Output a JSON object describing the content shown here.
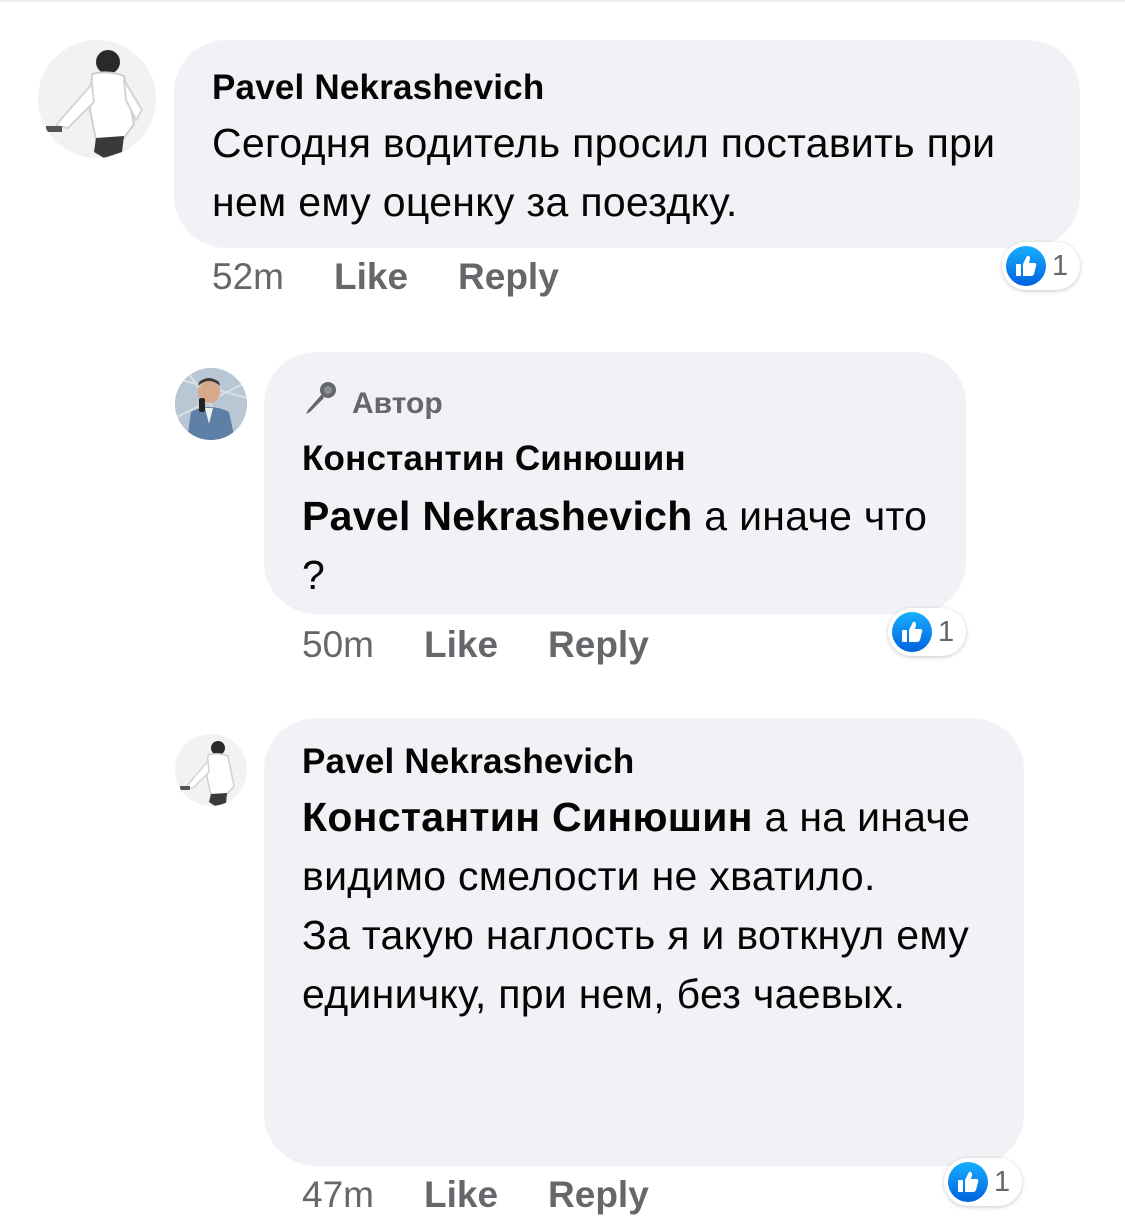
{
  "colors": {
    "bubble_bg": "#f0f2f5",
    "meta_text": "#65676b",
    "like_blue": "#1877f2"
  },
  "comments": [
    {
      "author": "Pavel Nekrashevich",
      "text": "Сегодня водитель просил поставить при нем ему оценку за поездку.",
      "time": "52m",
      "like_label": "Like",
      "reply_label": "Reply",
      "reaction_count": "1",
      "reaction_icon": "thumbs-up-icon",
      "avatar_icon": "person-avatar"
    },
    {
      "badge_label": "Автор",
      "badge_icon": "microphone-icon",
      "author": "Константин Синюшин",
      "mention": "Pavel Nekrashevich",
      "text": " а иначе что ?",
      "time": "50m",
      "like_label": "Like",
      "reply_label": "Reply",
      "reaction_count": "1",
      "reaction_icon": "thumbs-up-icon",
      "avatar_icon": "person-avatar"
    },
    {
      "author": "Pavel Nekrashevich",
      "mention": "Константин Синюшин",
      "text": " а на иначе видимо смелости не хватило.",
      "text_2": "За такую наглость я и воткнул ему единичку, при нем, без чаевых.",
      "time": "47m",
      "like_label": "Like",
      "reply_label": "Reply",
      "reaction_count": "1",
      "reaction_icon": "thumbs-up-icon",
      "avatar_icon": "person-avatar"
    }
  ]
}
